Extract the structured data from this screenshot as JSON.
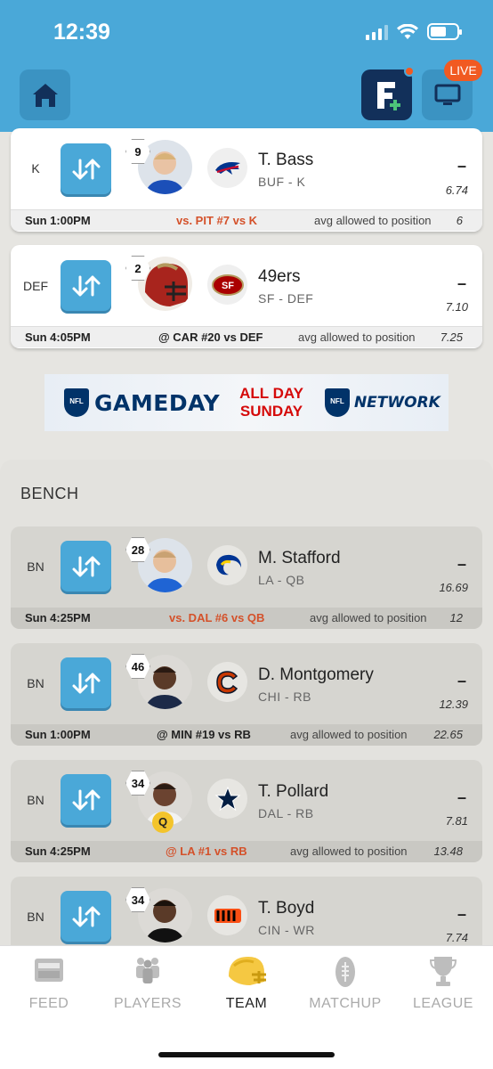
{
  "status": {
    "time": "12:39"
  },
  "header": {
    "live_label": "LIVE"
  },
  "starters": [
    {
      "pos": "K",
      "rank": "9",
      "name": "T. Bass",
      "team_pos": "BUF - K",
      "points": "–",
      "proj": "6.74",
      "day": "Sun 1:00PM",
      "opp": "vs. PIT #7 vs K",
      "avg_label": "avg allowed to position",
      "avg_value": "6"
    },
    {
      "pos": "DEF",
      "rank": "2",
      "name": "49ers",
      "team_pos": "SF - DEF",
      "points": "–",
      "proj": "7.10",
      "day": "Sun 4:05PM",
      "opp": "@ CAR #20 vs DEF",
      "avg_label": "avg allowed to position",
      "avg_value": "7.25"
    }
  ],
  "banner": {
    "gameday": "GAMEDAY",
    "allday_1": "ALL DAY",
    "allday_2": "SUNDAY",
    "nfl": "NFL",
    "network": "NETWORK"
  },
  "bench": {
    "title": "BENCH",
    "players": [
      {
        "pos": "BN",
        "rank": "28",
        "name": "M. Stafford",
        "team_pos": "LA - QB",
        "points": "–",
        "proj": "16.69",
        "day": "Sun 4:25PM",
        "opp": "vs. DAL #6 vs QB",
        "avg_label": "avg allowed to position",
        "avg_value": "12"
      },
      {
        "pos": "BN",
        "rank": "46",
        "name": "D. Montgomery",
        "team_pos": "CHI - RB",
        "points": "–",
        "proj": "12.39",
        "day": "Sun 1:00PM",
        "opp": "@ MIN #19 vs RB",
        "avg_label": "avg allowed to position",
        "avg_value": "22.65"
      },
      {
        "pos": "BN",
        "rank": "34",
        "name": "T. Pollard",
        "team_pos": "DAL - RB",
        "points": "–",
        "proj": "7.81",
        "status": "Q",
        "day": "Sun 4:25PM",
        "opp": "@ LA #1 vs RB",
        "avg_label": "avg allowed to position",
        "avg_value": "13.48"
      },
      {
        "pos": "BN",
        "rank": "34",
        "name": "T. Boyd",
        "team_pos": "CIN - WR",
        "points": "–",
        "proj": "7.74"
      }
    ]
  },
  "tabs": [
    {
      "label": "FEED"
    },
    {
      "label": "PLAYERS"
    },
    {
      "label": "TEAM"
    },
    {
      "label": "MATCHUP"
    },
    {
      "label": "LEAGUE"
    }
  ],
  "colors": {
    "accent": "#4aa8d8",
    "navy": "#12305a",
    "live": "#f15a22",
    "opp_red": "#d4512a"
  }
}
